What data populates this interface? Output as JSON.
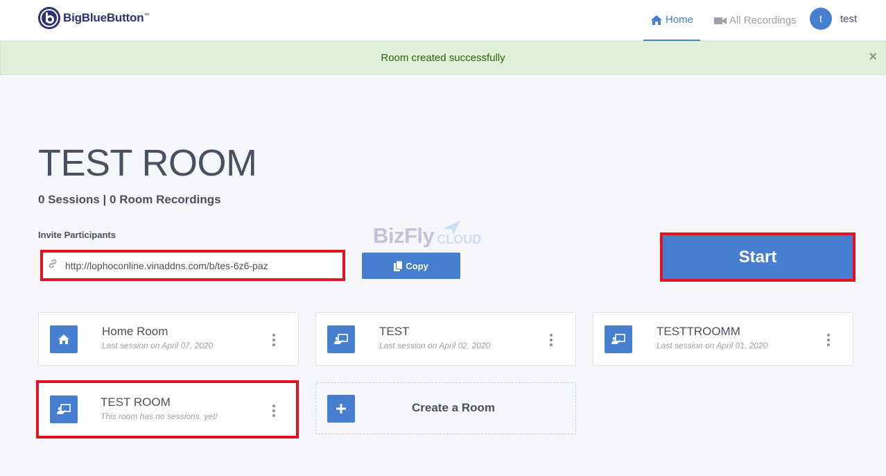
{
  "header": {
    "logo_text": "BigBlueButton",
    "logo_tm": "™",
    "nav": {
      "home": "Home",
      "recordings": "All Recordings"
    },
    "user": {
      "initial": "t",
      "name": "test"
    }
  },
  "alert": {
    "message": "Room created successfully",
    "close": "×"
  },
  "room": {
    "title": "TEST ROOM",
    "stats": "0 Sessions | 0 Room Recordings",
    "invite_label": "Invite Participants",
    "invite_url": "http://lophoconline.vinaddns.com/b/tes-6z6-paz",
    "copy_label": "Copy",
    "start_label": "Start"
  },
  "watermark": {
    "brand": "BizFly",
    "suffix": "CLOUD"
  },
  "rooms": [
    {
      "name": "Home Room",
      "subtitle": "Last session on April 07, 2020",
      "icon": "home-icon"
    },
    {
      "name": "TEST",
      "subtitle": "Last session on April 02, 2020",
      "icon": "presentation-icon"
    },
    {
      "name": "TESTTROOMM",
      "subtitle": "Last session on April 01, 2020",
      "icon": "presentation-icon"
    },
    {
      "name": "TEST ROOM",
      "subtitle": "This room has no sessions, yet!",
      "icon": "presentation-icon"
    }
  ],
  "create_room_label": "Create a Room",
  "colors": {
    "accent": "#467fcf",
    "highlight": "#e0131e",
    "alert_bg": "#def0d8",
    "brand_dark": "#283274"
  }
}
